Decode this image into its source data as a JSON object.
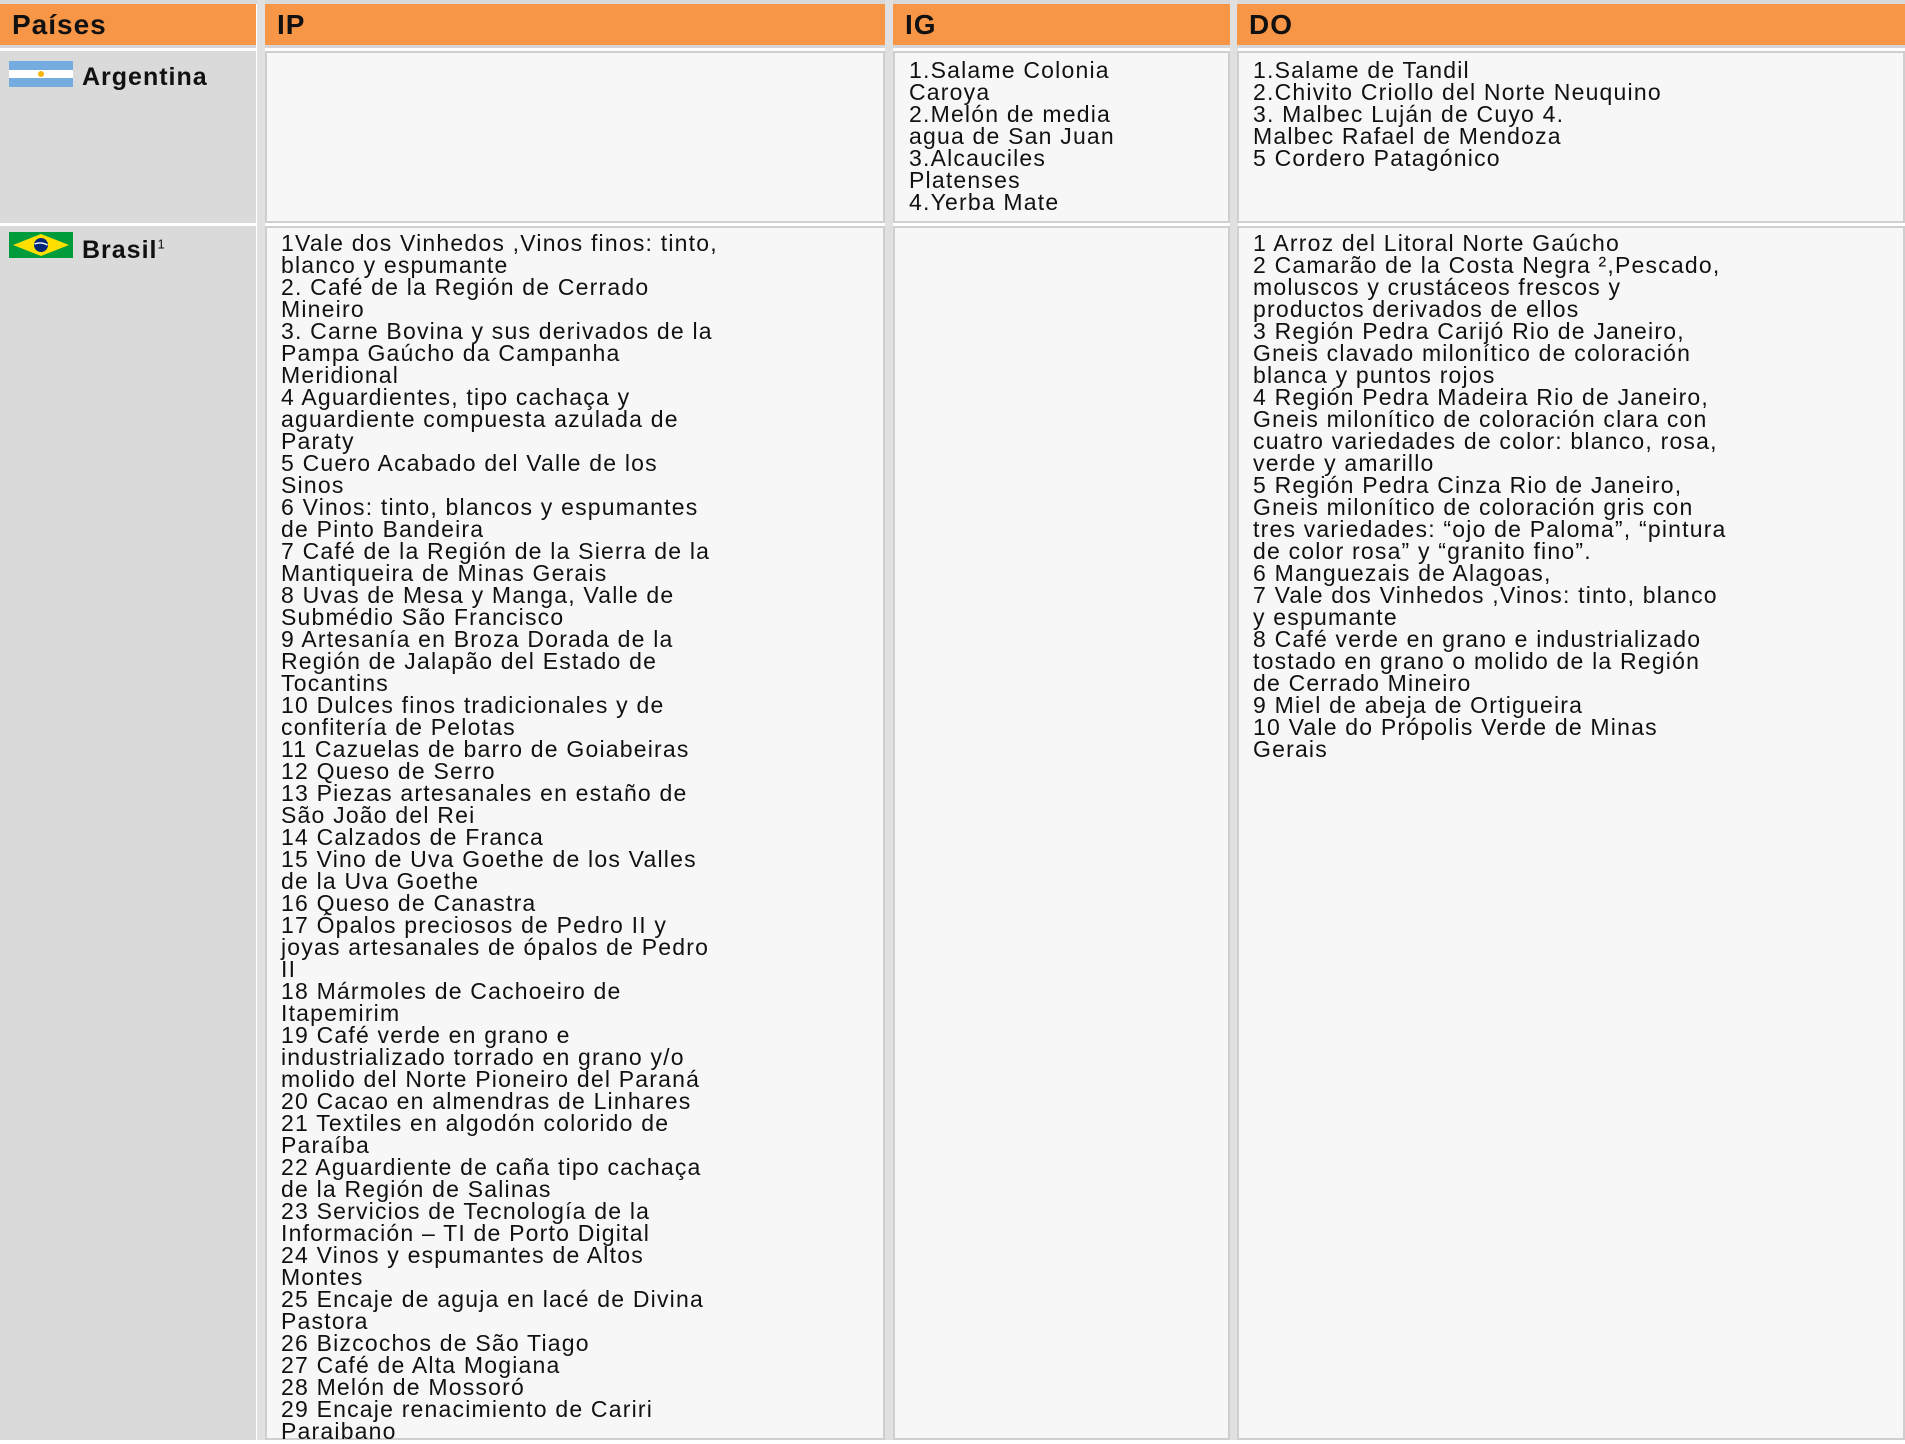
{
  "table": {
    "headers": [
      "Países",
      "IP",
      "IG",
      "DO"
    ],
    "rows": [
      {
        "country": "Argentina",
        "flag_icon": "argentina-flag-icon",
        "ip": [],
        "ig": [
          "1.Salame Colonia",
          "Caroya",
          "2.Melón de media",
          "agua de San Juan",
          "3.Alcauciles",
          "Platenses",
          "4.Yerba Mate"
        ],
        "do": [
          "1.Salame de Tandil",
          "2.Chivito Criollo del Norte  Neuquino",
          "3. Malbec Luján de Cuyo                    4.",
          "Malbec Rafael de Mendoza",
          "5 Cordero Patagónico"
        ]
      },
      {
        "country": "Brasil",
        "footnote": "1",
        "flag_icon": "brazil-flag-icon",
        "ip": [
          "1Vale dos Vinhedos ,Vinos finos: tinto,",
          "blanco y espumante",
          "2.  Café  de la Región de Cerrado",
          "Mineiro",
          "3. Carne Bovina y  sus derivados de la",
          "Pampa Gaúcho da Campanha",
          "Meridional",
          "4 Aguardientes, tipo cachaça y",
          "aguardiente compuesta azulada de",
          "Paraty",
          "5 Cuero Acabado del Valle de los",
          "Sinos",
          "6 Vinos: tinto, blancos y  espumantes",
          "de Pinto Bandeira",
          "7 Café de la Región de la Sierra de la",
          "Mantiqueira de Minas Gerais",
          "8 Uvas de Mesa y Manga, Valle de",
          "Submédio São Francisco",
          "9 Artesanía en Broza Dorada de la",
          "Región de Jalapão del Estado de",
          "Tocantins",
          "10 Dulces finos tradicionales y de",
          "confitería de Pelotas",
          "11 Cazuelas de barro de Goiabeiras",
          "12 Queso de Serro",
          "13 Piezas  artesanales en estaño de",
          "São João del Rei",
          "14 Calzados de Franca",
          "15 Vino de Uva Goethe de los Valles",
          "de la Uva Goethe",
          "16 Queso de  Canastra",
          "17 Ópalos preciosos de Pedro II y",
          "joyas artesanales de ópalos de Pedro",
          "II",
          "18 Mármoles de Cachoeiro de",
          "Itapemirim",
          "19 Café verde en grano e",
          "industrializado torrado en grano y/o",
          "molido del Norte Pioneiro del Paraná",
          "20 Cacao en almendras de Linhares",
          "21 Textiles en algodón colorido de",
          "Paraíba",
          "22 Aguardiente de caña tipo cachaça",
          "de la Región de Salinas",
          "23 Servicios de Tecnología de la",
          "Información – TI  de Porto Digital",
          "24 Vinos y  espumantes de Altos",
          "Montes",
          "25 Encaje de aguja en lacé de Divina",
          "Pastora",
          "26 Bizcochos de São Tiago",
          "27 Café de Alta Mogiana",
          "28 Melón de Mossoró",
          "29 Encaje renacimiento de Cariri",
          "Paraibano"
        ],
        "ig": [],
        "do": [
          "1 Arroz del Litoral Norte Gaúcho",
          "2 Camarão de la Costa Negra ²,Pescado,",
          "moluscos y crustáceos frescos y",
          "productos derivados de ellos",
          "3 Región Pedra Carijó Rio de Janeiro,",
          "Gneis clavado milonítico de coloración",
          "blanca y puntos rojos",
          "4 Región Pedra Madeira Rio de Janeiro,",
          "Gneis milonítico de coloración clara con",
          "cuatro variedades de color: blanco, rosa,",
          "verde y amarillo",
          "5 Región  Pedra Cinza Rio de Janeiro,",
          "Gneis milonítico de coloración gris con",
          "tres variedades: “ojo de Paloma”, “pintura",
          "de color rosa” y “granito fino”.",
          "6 Manguezais de Alagoas,",
          "7 Vale dos Vinhedos ,Vinos: tinto, blanco",
          "y espumante",
          "8 Café verde en grano e industrializado",
          "tostado en grano o molido de la Región",
          "de Cerrado Mineiro",
          "9  Miel de abeja de Ortigueira",
          "10 Vale do Própolis Verde de Minas",
          "Gerais"
        ]
      }
    ]
  },
  "colors": {
    "header_bg": "#f79646",
    "country_bg": "#dadada",
    "cell_bg": "#f7f7f7"
  }
}
